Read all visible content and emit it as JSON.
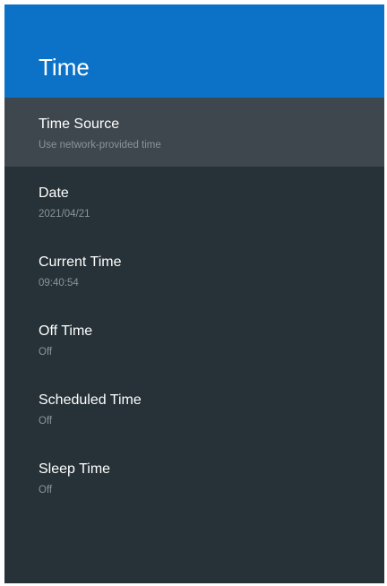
{
  "header": {
    "title": "Time"
  },
  "settings": {
    "items": [
      {
        "title": "Time Source",
        "value": "Use network-provided time"
      },
      {
        "title": "Date",
        "value": "2021/04/21"
      },
      {
        "title": "Current Time",
        "value": "09:40:54"
      },
      {
        "title": "Off Time",
        "value": "Off"
      },
      {
        "title": "Scheduled Time",
        "value": "Off"
      },
      {
        "title": "Sleep Time",
        "value": "Off"
      }
    ]
  },
  "colors": {
    "header_bg": "#0b72c8",
    "panel_bg": "#263238",
    "focused_row_bg": "#3e474d",
    "title_text": "#ffffff",
    "subtitle_text": "#8a9499"
  }
}
